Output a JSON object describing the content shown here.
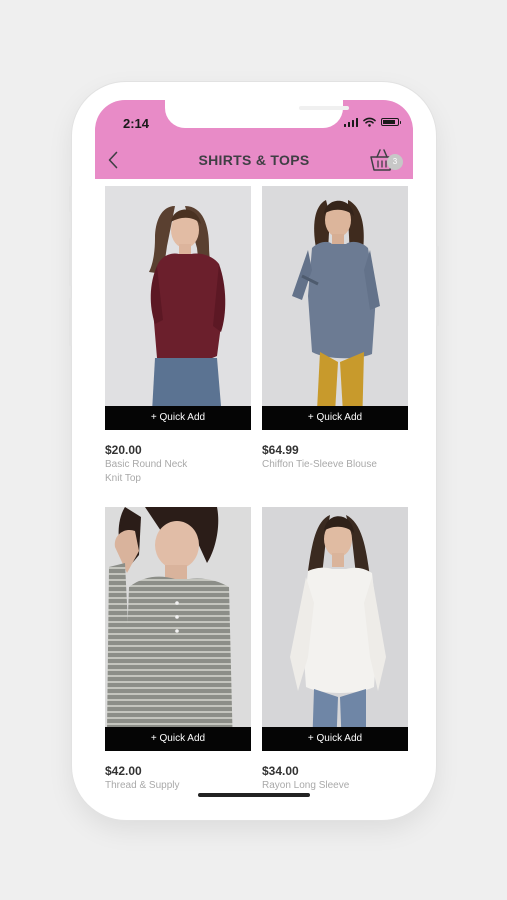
{
  "status_bar": {
    "time": "2:14"
  },
  "header": {
    "title": "SHIRTS & TOPS",
    "cart_count": "3"
  },
  "colors": {
    "header_bg": "#e88bc7",
    "button_bg": "#050505"
  },
  "products": [
    {
      "price": "$20.00",
      "name": "Basic Round Neck Knit Top",
      "quick_add": "+ Quick Add"
    },
    {
      "price": "$64.99",
      "name": "Chiffon Tie-Sleeve Blouse",
      "quick_add": "+ Quick Add"
    },
    {
      "price": "$42.00",
      "name": "Thread & Supply",
      "quick_add": "+ Quick Add"
    },
    {
      "price": "$34.00",
      "name": "Rayon Long Sleeve",
      "quick_add": "+ Quick Add"
    }
  ]
}
